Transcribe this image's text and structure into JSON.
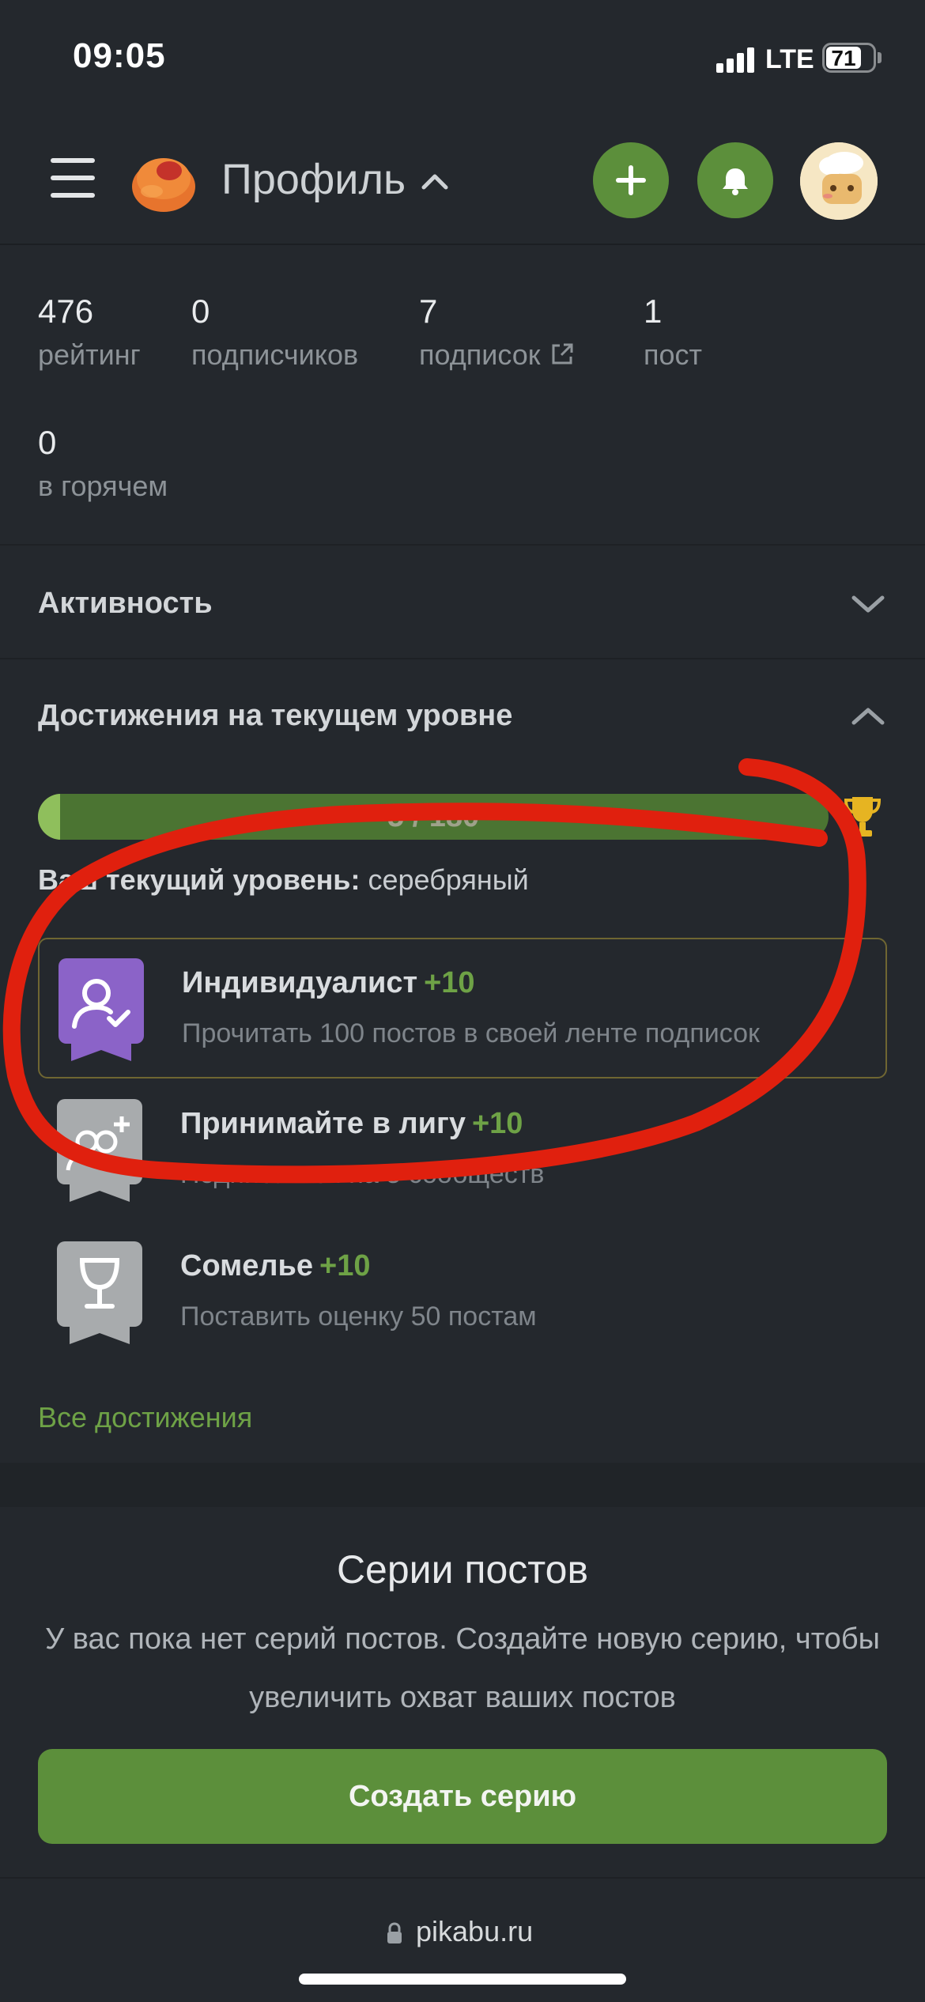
{
  "status_bar": {
    "time": "09:05",
    "network": "LTE",
    "battery": "71"
  },
  "header": {
    "title": "Профиль",
    "icons": [
      "menu-icon",
      "pikabu-logo",
      "chevron-up-icon",
      "plus-icon",
      "bell-icon",
      "avatar"
    ]
  },
  "stats": {
    "rating": {
      "value": "476",
      "label": "рейтинг"
    },
    "subscribers": {
      "value": "0",
      "label": "подписчиков"
    },
    "subscriptions": {
      "value": "7",
      "label": "подписок"
    },
    "posts": {
      "value": "1",
      "label": "пост"
    },
    "hot": {
      "value": "0",
      "label": "в горячем"
    }
  },
  "activity": {
    "title": "Активность"
  },
  "achievements": {
    "title": "Достижения на текущем уровне",
    "progress_text": "5 / 180",
    "progress_fraction": 0.028,
    "level_label": "Ваш текущий уровень:",
    "level_value": "серебряный",
    "items": [
      {
        "name": "Индивидуалист",
        "points": "+10",
        "description": "Прочитать 100 постов в своей ленте подписок",
        "badge_color": "#8b63c8"
      },
      {
        "name": "Принимайте в лигу",
        "points": "+10",
        "description": "Подписаться на 5 сообществ",
        "badge_color": "#a8abad"
      },
      {
        "name": "Сомелье",
        "points": "+10",
        "description": "Поставить оценку 50 постам",
        "badge_color": "#a8abad"
      }
    ],
    "all_link": "Все достижения"
  },
  "series": {
    "title": "Серии постов",
    "text": "У вас пока нет серий постов. Создайте новую серию, чтобы увеличить охват ваших постов",
    "button": "Создать серию"
  },
  "browser": {
    "url": "pikabu.ru"
  },
  "colors": {
    "background": "#24282d",
    "accent_green": "#5c8f3b",
    "link_green": "#6ea246",
    "annotation_red": "#e0200e"
  }
}
